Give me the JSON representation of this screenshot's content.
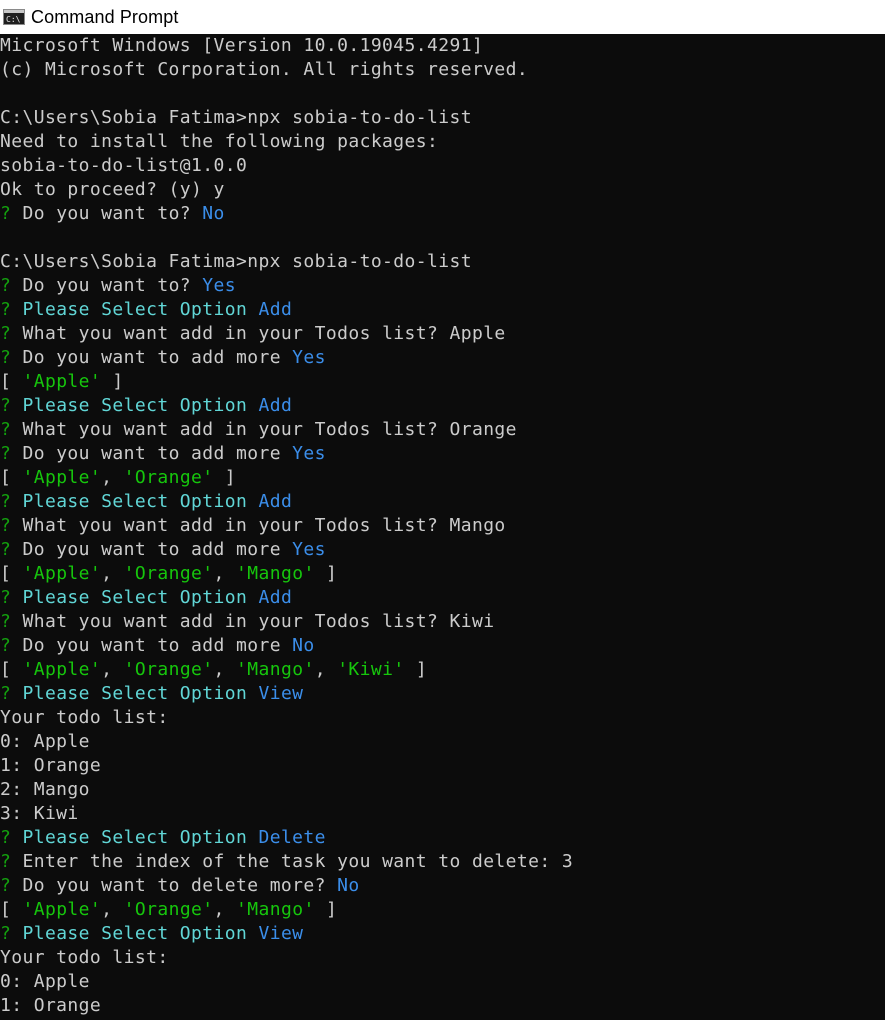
{
  "window": {
    "title": "Command Prompt",
    "icon": "cmd-icon"
  },
  "colors": {
    "background": "#0c0c0c",
    "text": "#cccccc",
    "green": "#13a10e",
    "cyan": "#61d6d6",
    "blue": "#3b8eea",
    "string_green": "#16c60c"
  },
  "terminal": {
    "lines": [
      [
        {
          "t": "Microsoft Windows [Version 10.0.19045.4291]",
          "c": "text"
        }
      ],
      [
        {
          "t": "(c) Microsoft Corporation. All rights reserved.",
          "c": "text"
        }
      ],
      [],
      [
        {
          "t": "C:\\Users\\Sobia Fatima>npx sobia-to-do-list",
          "c": "text"
        }
      ],
      [
        {
          "t": "Need to install the following packages:",
          "c": "text"
        }
      ],
      [
        {
          "t": "sobia-to-do-list@1.0.0",
          "c": "text"
        }
      ],
      [
        {
          "t": "Ok to proceed? (y) y",
          "c": "text"
        }
      ],
      [
        {
          "t": "? ",
          "c": "green"
        },
        {
          "t": "Do you want to? ",
          "c": "text"
        },
        {
          "t": "No",
          "c": "blue"
        }
      ],
      [],
      [
        {
          "t": "C:\\Users\\Sobia Fatima>npx sobia-to-do-list",
          "c": "text"
        }
      ],
      [
        {
          "t": "? ",
          "c": "green"
        },
        {
          "t": "Do you want to? ",
          "c": "text"
        },
        {
          "t": "Yes",
          "c": "blue"
        }
      ],
      [
        {
          "t": "? ",
          "c": "green"
        },
        {
          "t": "Please Select Option ",
          "c": "cyan"
        },
        {
          "t": "Add",
          "c": "blue"
        }
      ],
      [
        {
          "t": "? ",
          "c": "green"
        },
        {
          "t": "What you want add in your Todos list? Apple",
          "c": "text"
        }
      ],
      [
        {
          "t": "? ",
          "c": "green"
        },
        {
          "t": "Do you want to add more ",
          "c": "text"
        },
        {
          "t": "Yes",
          "c": "blue"
        }
      ],
      [
        {
          "t": "[ ",
          "c": "text"
        },
        {
          "t": "'Apple'",
          "c": "string_green"
        },
        {
          "t": " ]",
          "c": "text"
        }
      ],
      [
        {
          "t": "? ",
          "c": "green"
        },
        {
          "t": "Please Select Option ",
          "c": "cyan"
        },
        {
          "t": "Add",
          "c": "blue"
        }
      ],
      [
        {
          "t": "? ",
          "c": "green"
        },
        {
          "t": "What you want add in your Todos list? Orange",
          "c": "text"
        }
      ],
      [
        {
          "t": "? ",
          "c": "green"
        },
        {
          "t": "Do you want to add more ",
          "c": "text"
        },
        {
          "t": "Yes",
          "c": "blue"
        }
      ],
      [
        {
          "t": "[ ",
          "c": "text"
        },
        {
          "t": "'Apple'",
          "c": "string_green"
        },
        {
          "t": ", ",
          "c": "text"
        },
        {
          "t": "'Orange'",
          "c": "string_green"
        },
        {
          "t": " ]",
          "c": "text"
        }
      ],
      [
        {
          "t": "? ",
          "c": "green"
        },
        {
          "t": "Please Select Option ",
          "c": "cyan"
        },
        {
          "t": "Add",
          "c": "blue"
        }
      ],
      [
        {
          "t": "? ",
          "c": "green"
        },
        {
          "t": "What you want add in your Todos list? Mango",
          "c": "text"
        }
      ],
      [
        {
          "t": "? ",
          "c": "green"
        },
        {
          "t": "Do you want to add more ",
          "c": "text"
        },
        {
          "t": "Yes",
          "c": "blue"
        }
      ],
      [
        {
          "t": "[ ",
          "c": "text"
        },
        {
          "t": "'Apple'",
          "c": "string_green"
        },
        {
          "t": ", ",
          "c": "text"
        },
        {
          "t": "'Orange'",
          "c": "string_green"
        },
        {
          "t": ", ",
          "c": "text"
        },
        {
          "t": "'Mango'",
          "c": "string_green"
        },
        {
          "t": " ]",
          "c": "text"
        }
      ],
      [
        {
          "t": "? ",
          "c": "green"
        },
        {
          "t": "Please Select Option ",
          "c": "cyan"
        },
        {
          "t": "Add",
          "c": "blue"
        }
      ],
      [
        {
          "t": "? ",
          "c": "green"
        },
        {
          "t": "What you want add in your Todos list? Kiwi",
          "c": "text"
        }
      ],
      [
        {
          "t": "? ",
          "c": "green"
        },
        {
          "t": "Do you want to add more ",
          "c": "text"
        },
        {
          "t": "No",
          "c": "blue"
        }
      ],
      [
        {
          "t": "[ ",
          "c": "text"
        },
        {
          "t": "'Apple'",
          "c": "string_green"
        },
        {
          "t": ", ",
          "c": "text"
        },
        {
          "t": "'Orange'",
          "c": "string_green"
        },
        {
          "t": ", ",
          "c": "text"
        },
        {
          "t": "'Mango'",
          "c": "string_green"
        },
        {
          "t": ", ",
          "c": "text"
        },
        {
          "t": "'Kiwi'",
          "c": "string_green"
        },
        {
          "t": " ]",
          "c": "text"
        }
      ],
      [
        {
          "t": "? ",
          "c": "green"
        },
        {
          "t": "Please Select Option ",
          "c": "cyan"
        },
        {
          "t": "View",
          "c": "blue"
        }
      ],
      [
        {
          "t": "Your todo list:",
          "c": "text"
        }
      ],
      [
        {
          "t": "0: Apple",
          "c": "text"
        }
      ],
      [
        {
          "t": "1: Orange",
          "c": "text"
        }
      ],
      [
        {
          "t": "2: Mango",
          "c": "text"
        }
      ],
      [
        {
          "t": "3: Kiwi",
          "c": "text"
        }
      ],
      [
        {
          "t": "? ",
          "c": "green"
        },
        {
          "t": "Please Select Option ",
          "c": "cyan"
        },
        {
          "t": "Delete",
          "c": "blue"
        }
      ],
      [
        {
          "t": "? ",
          "c": "green"
        },
        {
          "t": "Enter the index of the task you want to delete: 3",
          "c": "text"
        }
      ],
      [
        {
          "t": "? ",
          "c": "green"
        },
        {
          "t": "Do you want to delete more? ",
          "c": "text"
        },
        {
          "t": "No",
          "c": "blue"
        }
      ],
      [
        {
          "t": "[ ",
          "c": "text"
        },
        {
          "t": "'Apple'",
          "c": "string_green"
        },
        {
          "t": ", ",
          "c": "text"
        },
        {
          "t": "'Orange'",
          "c": "string_green"
        },
        {
          "t": ", ",
          "c": "text"
        },
        {
          "t": "'Mango'",
          "c": "string_green"
        },
        {
          "t": " ]",
          "c": "text"
        }
      ],
      [
        {
          "t": "? ",
          "c": "green"
        },
        {
          "t": "Please Select Option ",
          "c": "cyan"
        },
        {
          "t": "View",
          "c": "blue"
        }
      ],
      [
        {
          "t": "Your todo list:",
          "c": "text"
        }
      ],
      [
        {
          "t": "0: Apple",
          "c": "text"
        }
      ],
      [
        {
          "t": "1: Orange",
          "c": "text"
        }
      ]
    ]
  }
}
